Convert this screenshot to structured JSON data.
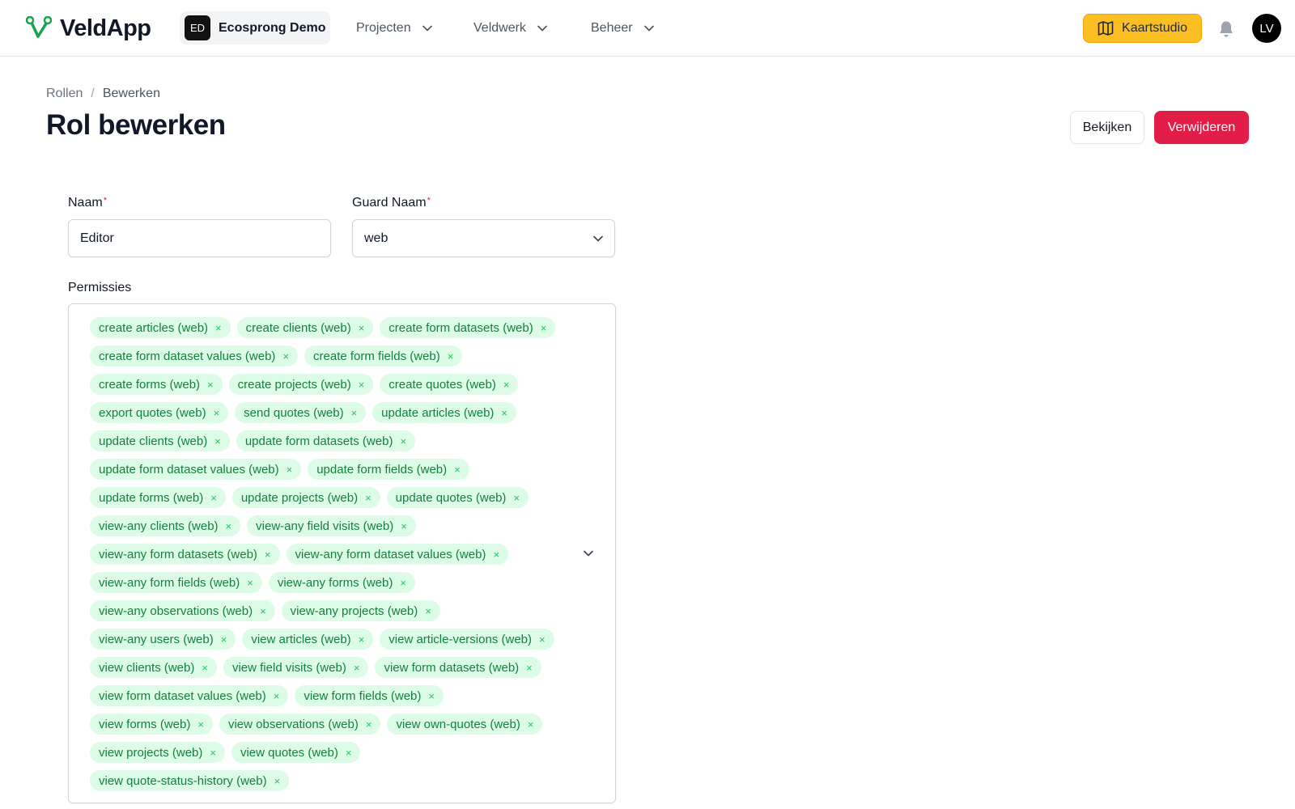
{
  "app": {
    "name": "VeldApp",
    "brand_color": "#22c55e"
  },
  "tenant": {
    "initials": "ED",
    "name": "Ecosprong Demo"
  },
  "nav": [
    {
      "label": "Projecten"
    },
    {
      "label": "Veldwerk"
    },
    {
      "label": "Beheer"
    }
  ],
  "header_actions": {
    "studio_label": "Kaartstudio",
    "avatar_initials": "LV"
  },
  "breadcrumb": {
    "parent": "Rollen",
    "separator": "/",
    "current": "Bewerken"
  },
  "page": {
    "title": "Rol bewerken",
    "view_label": "Bekijken",
    "delete_label": "Verwijderen"
  },
  "form": {
    "name_label": "Naam",
    "name_value": "Editor",
    "guard_label": "Guard Naam",
    "guard_value": "web",
    "required_marker": "*",
    "permissions_label": "Permissies",
    "remove_glyph": "×",
    "permissions": [
      "create articles (web)",
      "create clients (web)",
      "create form datasets (web)",
      "create form dataset values (web)",
      "create form fields (web)",
      "create forms (web)",
      "create projects (web)",
      "create quotes (web)",
      "export quotes (web)",
      "send quotes (web)",
      "update articles (web)",
      "update clients (web)",
      "update form datasets (web)",
      "update form dataset values (web)",
      "update form fields (web)",
      "update forms (web)",
      "update projects (web)",
      "update quotes (web)",
      "view-any clients (web)",
      "view-any field visits (web)",
      "view-any form datasets (web)",
      "view-any form dataset values (web)",
      "view-any form fields (web)",
      "view-any forms (web)",
      "view-any observations (web)",
      "view-any projects (web)",
      "view-any users (web)",
      "view articles (web)",
      "view article-versions (web)",
      "view clients (web)",
      "view field visits (web)",
      "view form datasets (web)",
      "view form dataset values (web)",
      "view form fields (web)",
      "view forms (web)",
      "view observations (web)",
      "view own-quotes (web)",
      "view projects (web)",
      "view quotes (web)",
      "view quote-status-history (web)"
    ]
  },
  "colors": {
    "accent_yellow": "#fbbf24",
    "danger": "#e11d48",
    "tag_bg": "#dcfce7",
    "tag_text": "#15803d"
  },
  "icons": [
    "veldapp-logo-icon",
    "chevron-down-icon",
    "map-icon",
    "bell-icon",
    "close-icon"
  ]
}
